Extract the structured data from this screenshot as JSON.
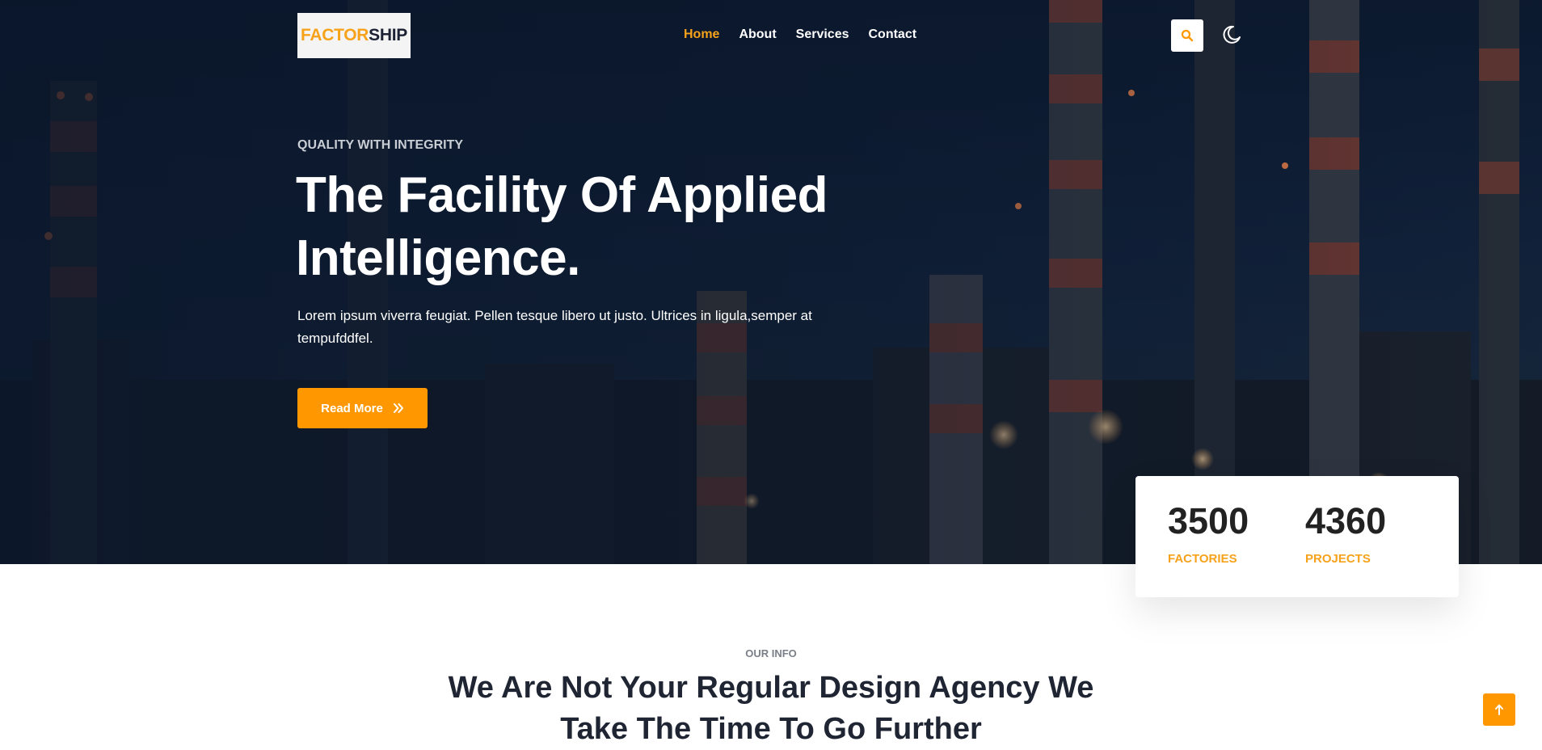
{
  "brand": {
    "logo_part1": "FACTOR",
    "logo_part2": "SHIP",
    "accent_color": "#f7a21b",
    "button_color": "#ff9800"
  },
  "nav": {
    "items": [
      {
        "label": "Home",
        "active": true
      },
      {
        "label": "About",
        "active": false
      },
      {
        "label": "Services",
        "active": false
      },
      {
        "label": "Contact",
        "active": false
      }
    ],
    "search_icon": "search-icon",
    "theme_icon": "moon-icon"
  },
  "hero": {
    "eyebrow": "QUALITY WITH INTEGRITY",
    "title_line1": "The Facility Of Applied",
    "title_line2": "Intelligence.",
    "lead": "Lorem ipsum viverra feugiat. Pellen tesque libero ut justo. Ultrices in ligula,semper at tempufddfel.",
    "cta_label": "Read More",
    "cta_icon": "double-chevron-right-icon",
    "background": "industrial-chimneys-night"
  },
  "stats": [
    {
      "value": "3500",
      "label": "FACTORIES"
    },
    {
      "value": "4360",
      "label": "PROJECTS"
    }
  ],
  "info": {
    "eyebrow": "OUR INFO",
    "title_line1": "We Are Not Your Regular Design Agency We",
    "title_line2": "Take The Time To Go Further"
  },
  "back_to_top": {
    "icon": "arrow-up-icon"
  }
}
